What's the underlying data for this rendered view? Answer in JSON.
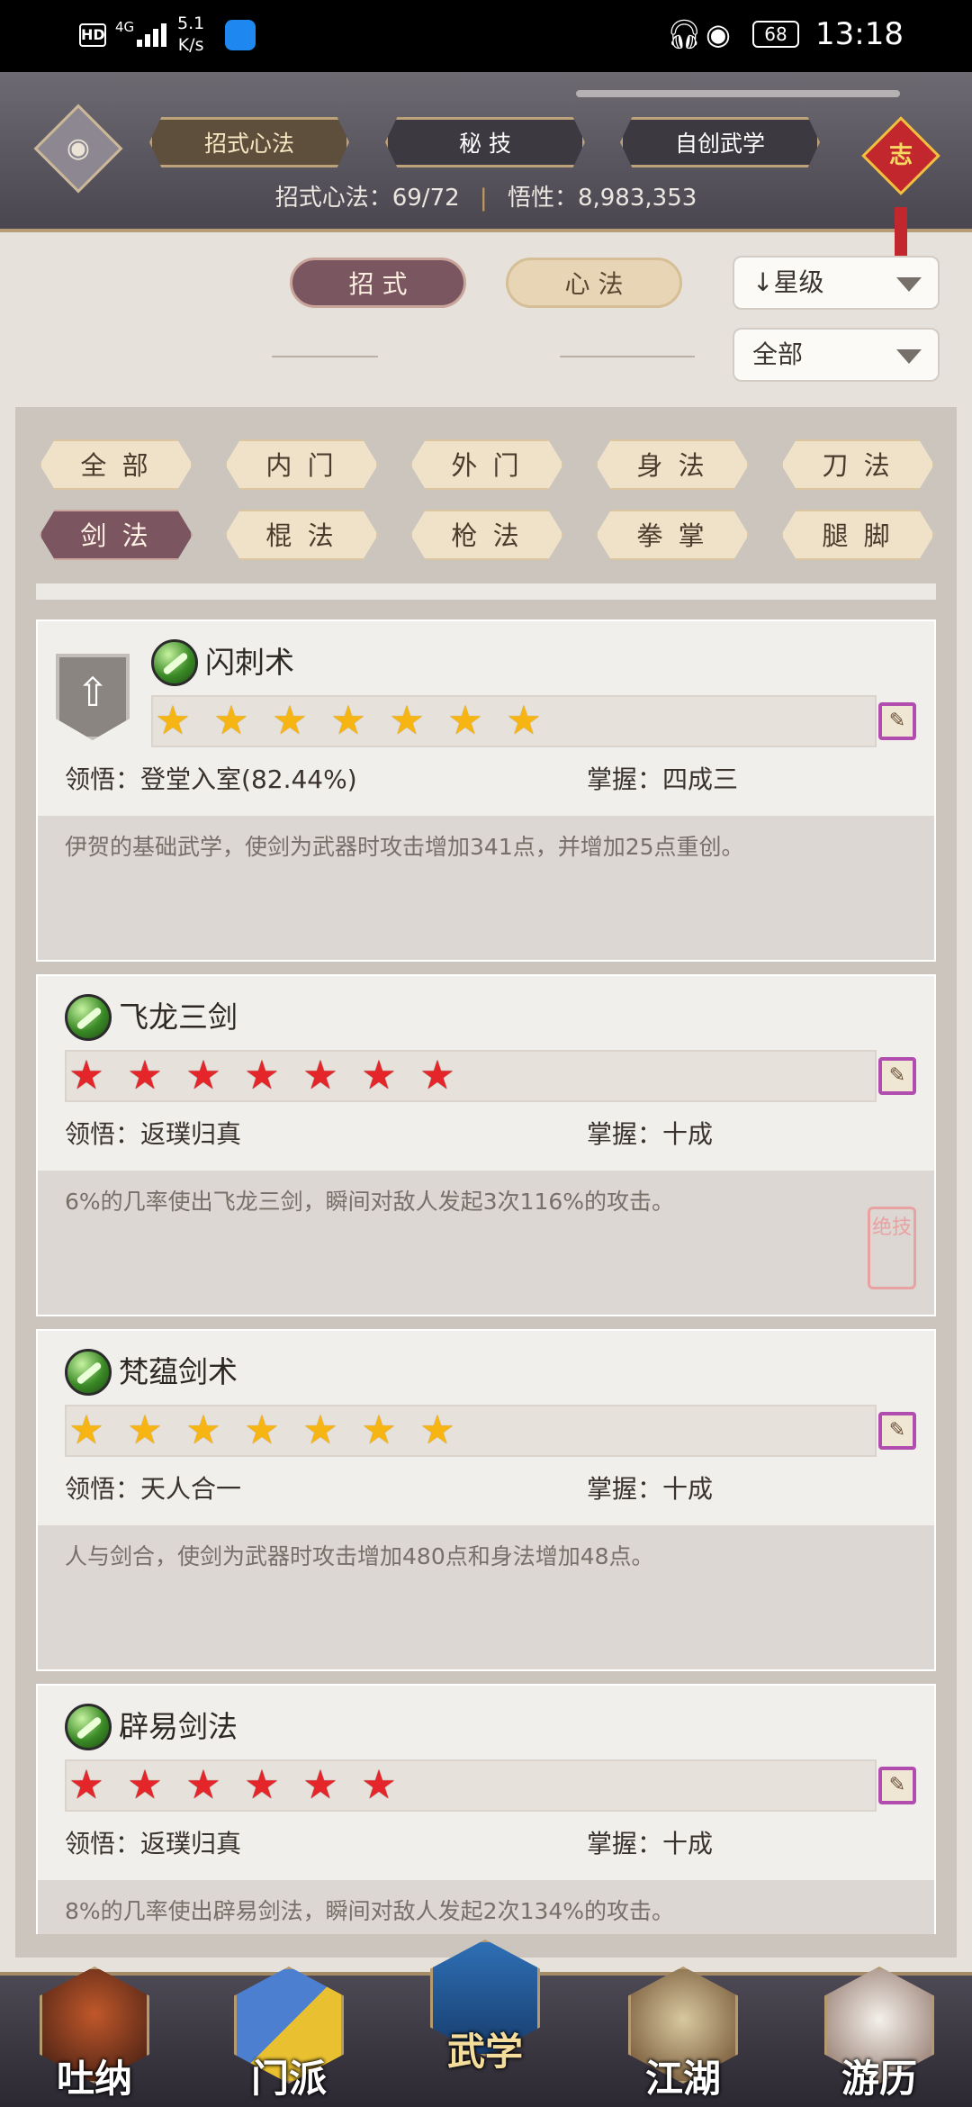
{
  "status_bar": {
    "hd": "HD",
    "network": "4G",
    "speed_value": "5.1",
    "speed_unit": "K/s",
    "battery": "68",
    "time": "13:18"
  },
  "header": {
    "tabs": [
      "招式心法",
      "秘 技",
      "自创武学"
    ],
    "active_tab": 0,
    "info_left": "招式心法：69/72",
    "info_sep": "|",
    "info_right": "悟性：8,983,353",
    "knot_char": "志"
  },
  "filters": {
    "segments": [
      "招 式",
      "心 法"
    ],
    "active_segment": 0,
    "sort_select": "星级",
    "sort_arrow": "↓",
    "scope_select": "全部"
  },
  "categories": {
    "row1": [
      "全 部",
      "内 门",
      "外 门",
      "身 法",
      "刀 法"
    ],
    "row2": [
      "剑 法",
      "棍 法",
      "枪 法",
      "拳 掌",
      "腿 脚"
    ],
    "active": "剑 法"
  },
  "skills": [
    {
      "name": "闪刺术",
      "stars": 7,
      "star_color": "gold",
      "has_upgrade": true,
      "comprehension_label": "领悟：",
      "comprehension": "登堂入室(82.44%)",
      "mastery_label": "掌握：",
      "mastery": "四成三",
      "description": "伊贺的基础武学，使剑为武器时攻击增加341点，并增加25点重创。",
      "icon": "scroll-icon"
    },
    {
      "name": "飞龙三剑",
      "stars": 7,
      "star_color": "red",
      "has_upgrade": false,
      "comprehension_label": "领悟：",
      "comprehension": "返璞归真",
      "mastery_label": "掌握：",
      "mastery": "十成",
      "description": "6%的几率使出飞龙三剑，瞬间对敌人发起3次116%的攻击。",
      "icon": "scroll-icon",
      "seal": "绝技"
    },
    {
      "name": "梵蕴剑术",
      "stars": 7,
      "star_color": "gold",
      "has_upgrade": false,
      "comprehension_label": "领悟：",
      "comprehension": "天人合一",
      "mastery_label": "掌握：",
      "mastery": "十成",
      "description": "人与剑合，使剑为武器时攻击增加480点和身法增加48点。",
      "icon": "scroll-icon"
    },
    {
      "name": "辟易剑法",
      "stars": 6,
      "star_color": "red",
      "has_upgrade": false,
      "comprehension_label": "领悟：",
      "comprehension": "返璞归真",
      "mastery_label": "掌握：",
      "mastery": "十成",
      "description": "8%的几率使出辟易剑法，瞬间对敌人发起2次134%的攻击。",
      "icon": "scroll-icon"
    }
  ],
  "bottom_nav": [
    "吐纳",
    "门派",
    "武学",
    "江湖",
    "游历"
  ],
  "bottom_nav_active": 2,
  "colors": {
    "accent_active": "#7a5660",
    "gold_star": "#f7b514",
    "red_star": "#e4262a",
    "header_bg": "#4a4650"
  }
}
